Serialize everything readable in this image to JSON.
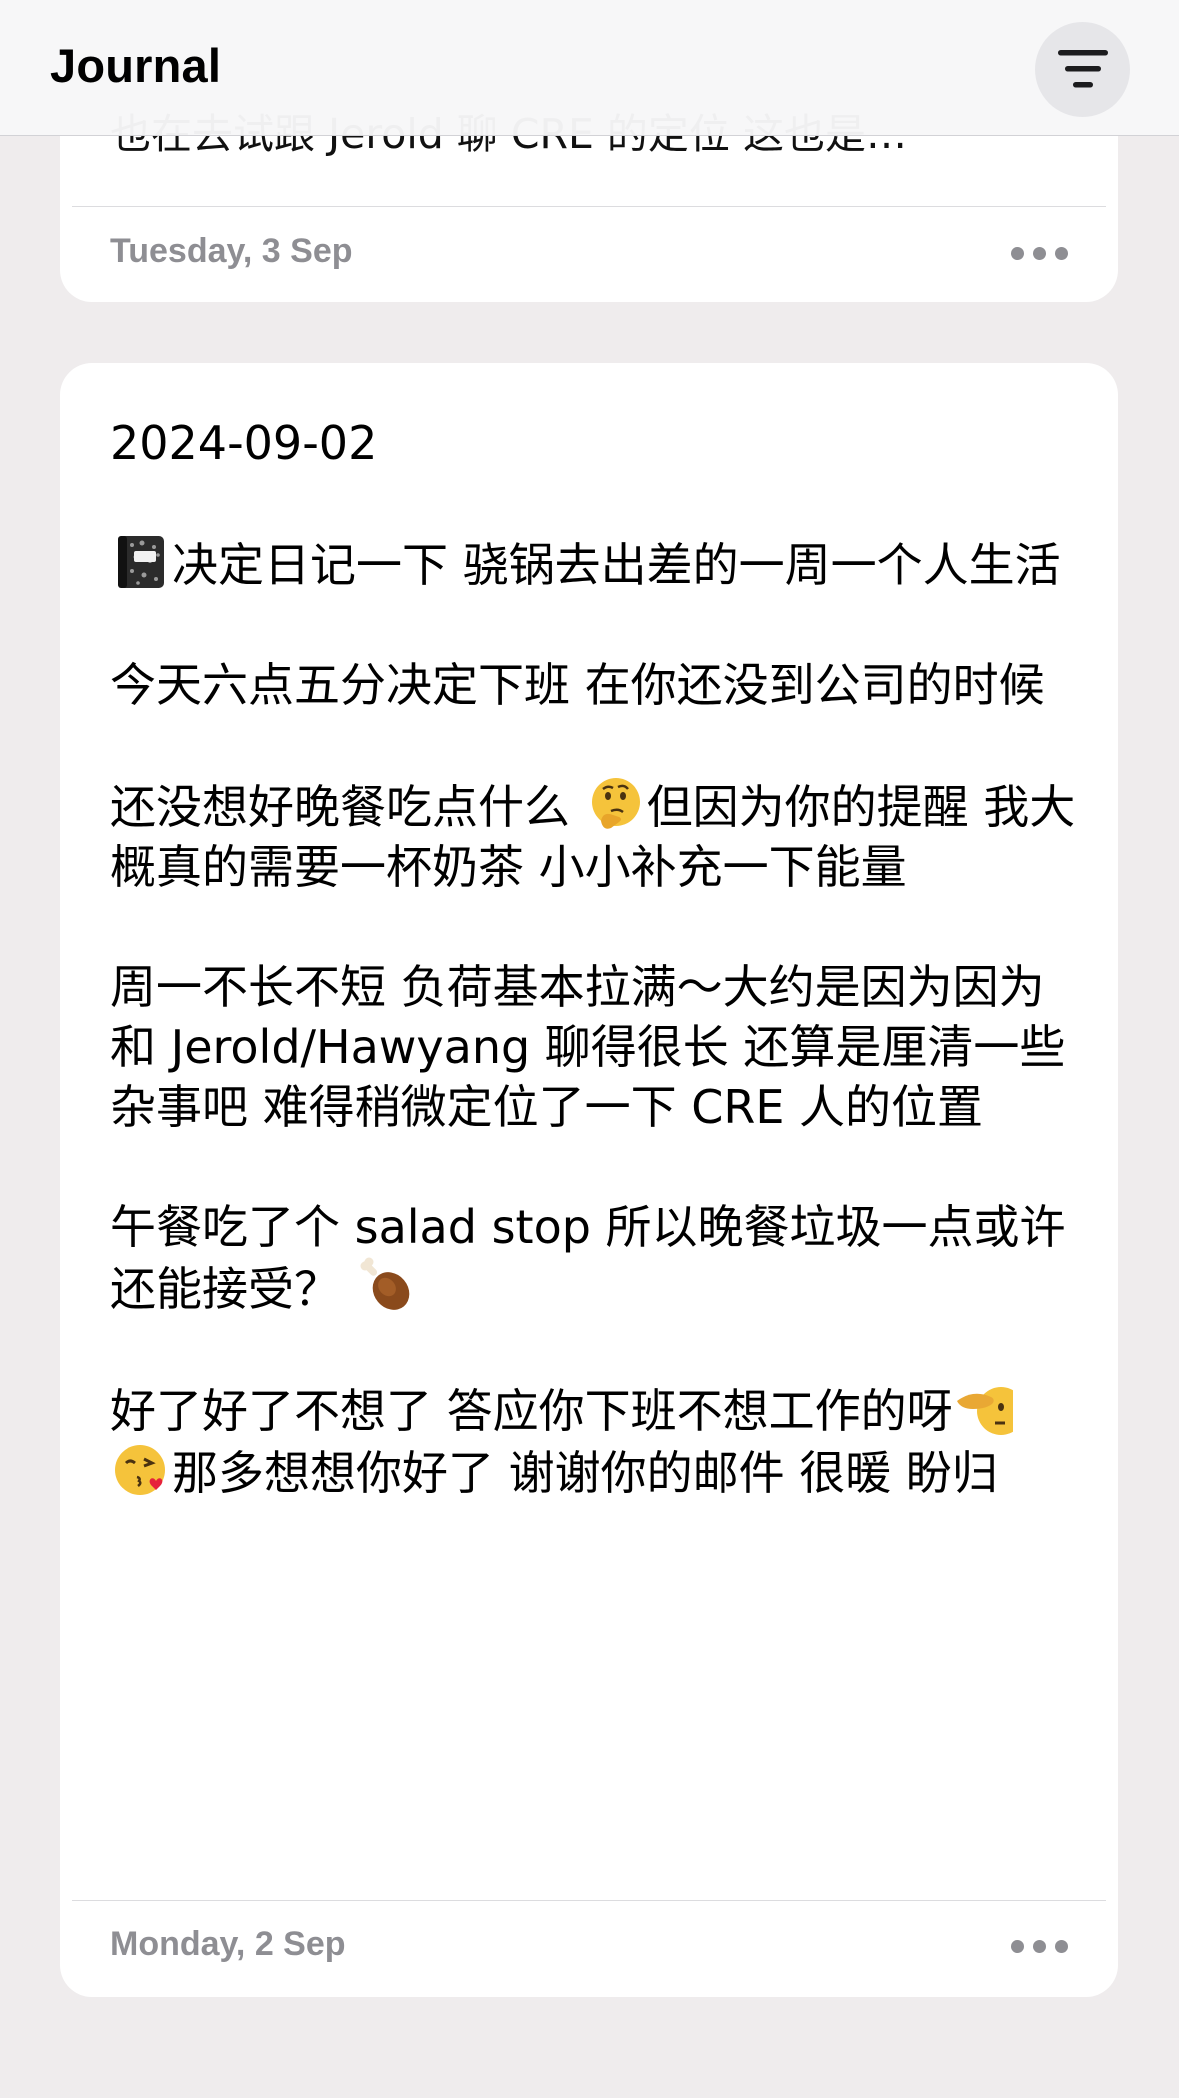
{
  "header": {
    "title": "Journal",
    "filter_icon": "filter-lines-icon"
  },
  "entries": [
    {
      "preview": "也在去试跟 Jerold 聊 CRE 的定位 这也是…",
      "date": "Tuesday, 3 Sep",
      "more_icon": "ellipsis-icon"
    },
    {
      "title": "2024-09-02",
      "paragraphs": [
        {
          "emoji_before": "notebook-emoji",
          "text": "决定日记一下 骁锅去出差的一周一个人生活"
        },
        {
          "text": "今天六点五分决定下班 在你还没到公司的时候"
        },
        {
          "text_a": "还没想好晚餐吃点什么 ",
          "emoji": "thinking-face-emoji",
          "text_b": "但因为你的提醒 我大概真的需要一杯奶茶 小小补充一下能量"
        },
        {
          "text": "周一不长不短 负荷基本拉满～大约是因为因为和 Jerold/Hawyang 聊得很长 还算是厘清一些杂事吧 难得稍微定位了一下 CRE 人的位置"
        },
        {
          "text": "午餐吃了个 salad stop 所以晚餐垃圾一点或许还能接受？ ",
          "emoji_after": "poultry-leg-emoji"
        },
        {
          "text": "好了好了不想了 答应你下班不想工作的呀",
          "emoji_after": "saluting-face-emoji"
        },
        {
          "emoji_before": "face-blowing-kiss-emoji",
          "text": "那多想想你好了 谢谢你的邮件 很暖 盼归"
        }
      ],
      "date": "Monday, 2 Sep",
      "more_icon": "ellipsis-icon"
    }
  ]
}
